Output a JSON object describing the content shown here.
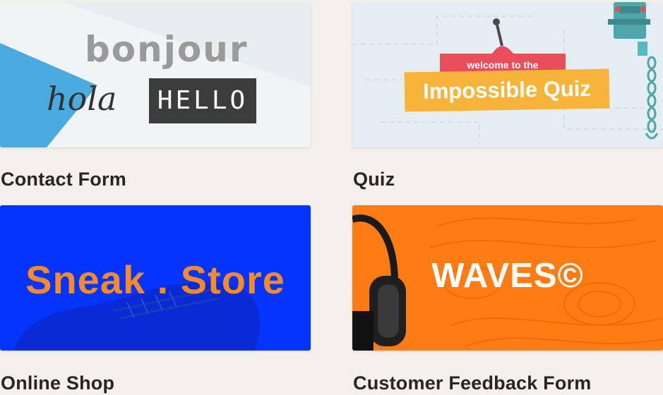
{
  "cards": [
    {
      "title": "Contact Form",
      "thumb": {
        "words": [
          "bonjour",
          "hola",
          "HELLO"
        ]
      }
    },
    {
      "title": "Quiz",
      "thumb": {
        "subtitle": "welcome to the",
        "title": "Impossible Quiz"
      }
    },
    {
      "title": "Online Shop",
      "thumb": {
        "title": "Sneak . Store"
      }
    },
    {
      "title": "Customer Feedback Form",
      "thumb": {
        "title": "WAVES©"
      }
    }
  ],
  "colors": {
    "background": "#f4efea",
    "caption": "#262627",
    "contact_triangle": "#4aabdf",
    "quiz_banner_red": "#e84d5b",
    "quiz_banner_yellow": "#f8b33b",
    "shop_blue": "#0534ff",
    "shop_text": "#f58a26",
    "feedback_orange": "#ff7c14"
  },
  "icons": [
    "lever-icon",
    "robot-arm-icon",
    "chain-icon",
    "sneaker-icon",
    "headphones-icon"
  ]
}
